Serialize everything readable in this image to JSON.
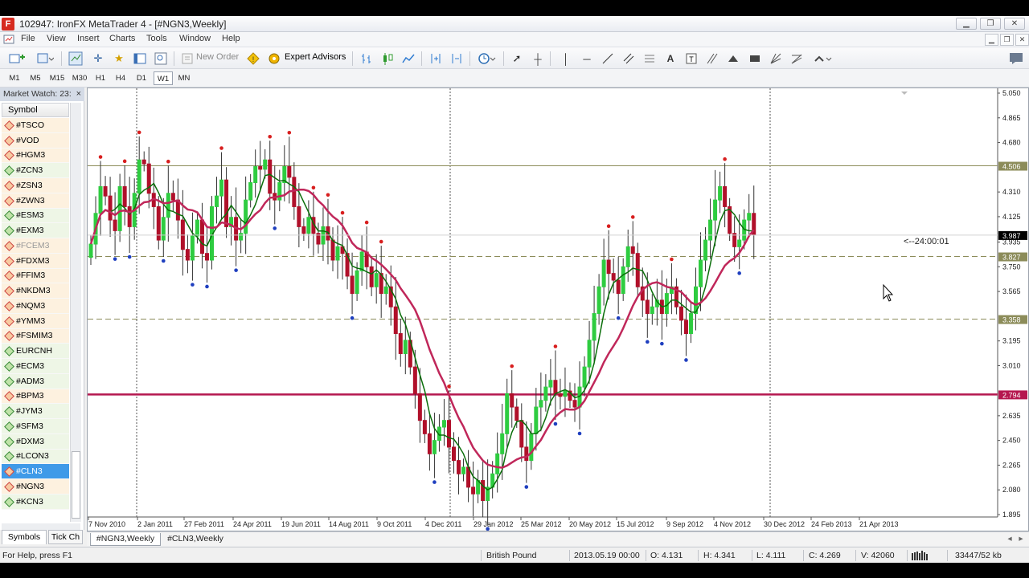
{
  "window": {
    "app_icon_letter": "F",
    "title": "102947: IronFX MetaTrader 4 - [#NGN3,Weekly]"
  },
  "menu": [
    "File",
    "View",
    "Insert",
    "Charts",
    "Tools",
    "Window",
    "Help"
  ],
  "toolbar": {
    "new_order_label": "New Order",
    "expert_advisors_label": "Expert Advisors"
  },
  "timeframes": [
    "M1",
    "M5",
    "M15",
    "M30",
    "H1",
    "H4",
    "D1",
    "W1",
    "MN"
  ],
  "timeframe_active": "W1",
  "market_watch": {
    "title": "Market Watch: 23:",
    "column_header": "Symbol",
    "symbols": [
      {
        "name": "#TSCO",
        "kind": "orange"
      },
      {
        "name": "#VOD",
        "kind": "orange"
      },
      {
        "name": "#HGM3",
        "kind": "orange"
      },
      {
        "name": "#ZCN3",
        "kind": "green"
      },
      {
        "name": "#ZSN3",
        "kind": "orange"
      },
      {
        "name": "#ZWN3",
        "kind": "orange"
      },
      {
        "name": "#ESM3",
        "kind": "green"
      },
      {
        "name": "#EXM3",
        "kind": "green"
      },
      {
        "name": "#FCEM3",
        "kind": "dim"
      },
      {
        "name": "#FDXM3",
        "kind": "orange"
      },
      {
        "name": "#FFIM3",
        "kind": "orange"
      },
      {
        "name": "#NKDM3",
        "kind": "orange"
      },
      {
        "name": "#NQM3",
        "kind": "orange"
      },
      {
        "name": "#YMM3",
        "kind": "orange"
      },
      {
        "name": "#FSMIM3",
        "kind": "orange"
      },
      {
        "name": "EURCNH",
        "kind": "green"
      },
      {
        "name": "#ECM3",
        "kind": "green"
      },
      {
        "name": "#ADM3",
        "kind": "green"
      },
      {
        "name": "#BPM3",
        "kind": "orange"
      },
      {
        "name": "#JYM3",
        "kind": "green"
      },
      {
        "name": "#SFM3",
        "kind": "green"
      },
      {
        "name": "#DXM3",
        "kind": "green"
      },
      {
        "name": "#LCON3",
        "kind": "green"
      },
      {
        "name": "#CLN3",
        "kind": "selected"
      },
      {
        "name": "#NGN3",
        "kind": "orange"
      },
      {
        "name": "#KCN3",
        "kind": "green"
      }
    ],
    "tabs": [
      "Symbols",
      "Tick Ch"
    ]
  },
  "chart_tabs": [
    "#NGN3,Weekly",
    "#CLN3,Weekly"
  ],
  "chart": {
    "countdown": "<--24:00:01",
    "price_labels": [
      "5.050",
      "4.865",
      "4.680",
      "4.310",
      "4.125",
      "3.935",
      "3.750",
      "3.565",
      "3.195",
      "3.010",
      "2.635",
      "2.450",
      "2.265",
      "2.080",
      "1.895"
    ],
    "price_values": [
      5.05,
      4.865,
      4.68,
      4.31,
      4.125,
      3.935,
      3.75,
      3.565,
      3.195,
      3.01,
      2.635,
      2.45,
      2.265,
      2.08,
      1.895
    ],
    "levels": [
      {
        "value": 4.506,
        "label": "4.506",
        "style": "solid",
        "color": "#8c8c5a"
      },
      {
        "value": 3.827,
        "label": "3.827",
        "style": "dashed",
        "color": "#8c8c5a"
      },
      {
        "value": 3.358,
        "label": "3.358",
        "style": "dashed",
        "color": "#8c8c5a"
      },
      {
        "value": 2.794,
        "label": "2.794",
        "style": "thick",
        "color": "#b5174f"
      }
    ],
    "current_price": {
      "value": 3.987,
      "label": "3.987"
    },
    "date_labels": [
      "7 Nov 2010",
      "2 Jan 2011",
      "27 Feb 2011",
      "24 Apr 2011",
      "19 Jun 2011",
      "14 Aug 2011",
      "9 Oct 2011",
      "4 Dec 2011",
      "29 Jan 2012",
      "25 Mar 2012",
      "20 May 2012",
      "15 Jul 2012",
      "9 Sep 2012",
      "4 Nov 2012",
      "30 Dec 2012",
      "24 Feb 2013",
      "21 Apr 2013"
    ],
    "colors": {
      "bull": "#2ecc40",
      "bear": "#b0102a",
      "fast_ma": "#0a6e0a",
      "slow_ma": "#c0275a",
      "fractal_up": "#d81f1f",
      "fractal_down": "#1f3fbf"
    }
  },
  "chart_data": {
    "type": "candlestick",
    "series": [
      {
        "name": "closes",
        "values": [
          3.92,
          4.15,
          4.35,
          4.28,
          4.1,
          4.02,
          4.35,
          4.2,
          4.05,
          4.3,
          4.55,
          4.52,
          4.3,
          4.2,
          3.95,
          4.12,
          4.3,
          4.25,
          4.1,
          3.88,
          3.8,
          3.98,
          4.1,
          3.85,
          3.8,
          4.2,
          4.28,
          4.4,
          4.05,
          4.12,
          3.95,
          4.0,
          4.25,
          4.38,
          4.5,
          4.48,
          4.55,
          4.3,
          4.25,
          4.38,
          4.5,
          4.42,
          4.2,
          4.05,
          4.0,
          4.12,
          4.0,
          3.92,
          4.05,
          3.95,
          3.8,
          3.9,
          3.85,
          3.68,
          3.55,
          3.72,
          3.86,
          3.75,
          3.6,
          3.7,
          3.55,
          3.6,
          3.45,
          3.25,
          3.1,
          3.2,
          3.0,
          2.8,
          2.6,
          2.5,
          2.35,
          2.45,
          2.55,
          2.6,
          2.4,
          2.3,
          2.2,
          2.25,
          2.1,
          2.05,
          2.15,
          2.0,
          2.1,
          2.2,
          2.35,
          2.5,
          2.8,
          2.7,
          2.6,
          2.4,
          2.3,
          2.5,
          2.7,
          2.75,
          2.85,
          2.9,
          2.8,
          2.78,
          2.82,
          2.75,
          2.7,
          2.85,
          3.0,
          3.2,
          3.4,
          3.6,
          3.8,
          3.7,
          3.65,
          3.55,
          3.75,
          3.9,
          3.85,
          3.6,
          3.5,
          3.4,
          3.45,
          3.5,
          3.4,
          3.55,
          3.6,
          3.45,
          3.35,
          3.25,
          3.4,
          3.6,
          3.8,
          3.95,
          4.1,
          4.25,
          4.35,
          4.2,
          4.0,
          3.9,
          3.95,
          4.1,
          4.15,
          3.99
        ]
      },
      {
        "name": "fast_ma",
        "values": []
      },
      {
        "name": "slow_ma",
        "values": []
      }
    ],
    "ylim": [
      1.895,
      5.05
    ]
  },
  "status": {
    "help": "For Help, press F1",
    "profile": "British Pound",
    "datetime": "2013.05.19 00:00",
    "open": "O: 4.131",
    "high": "H: 4.341",
    "low": "L: 4.111",
    "close": "C: 4.269",
    "volume": "V: 42060",
    "traffic": "33447/52 kb"
  }
}
